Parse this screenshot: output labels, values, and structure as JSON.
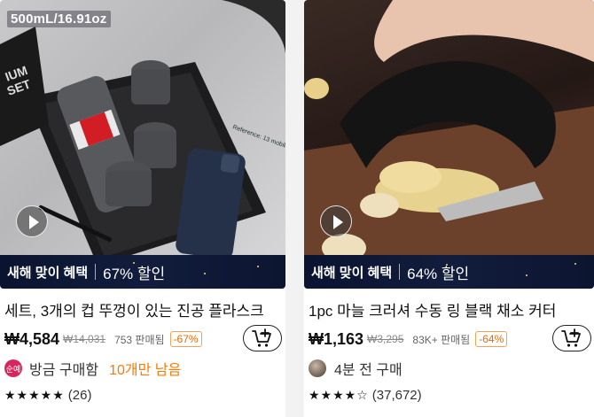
{
  "products": [
    {
      "image_label": "500mL/16.91oz",
      "promo_tag": "새해 맞이 혜택",
      "promo_discount": "67% 할인",
      "title": "세트, 3개의 컵 뚜껑이 있는 진공 플라스크",
      "price": "₩4,584",
      "original_price": "₩14,031",
      "sold": "753 판매됨",
      "discount_badge": "-67%",
      "seller_badge": "순예",
      "status": "방금 구매함",
      "stock": "10개만 남음",
      "stars": "★★★★★",
      "rating_count": "(26)"
    },
    {
      "image_label": "",
      "promo_tag": "새해 맞이 혜택",
      "promo_discount": "64% 할인",
      "title": "1pc 마늘 크러셔 수동 링 블랙 채소 커터",
      "price": "₩1,163",
      "original_price": "₩3,295",
      "sold": "83K+ 판매됨",
      "discount_badge": "-64%",
      "status": "4분 전 구매",
      "stars": "★★★★☆",
      "rating_count": "(37,672)"
    }
  ],
  "icons": {
    "play": "play-icon",
    "cart": "add-to-cart-icon"
  }
}
